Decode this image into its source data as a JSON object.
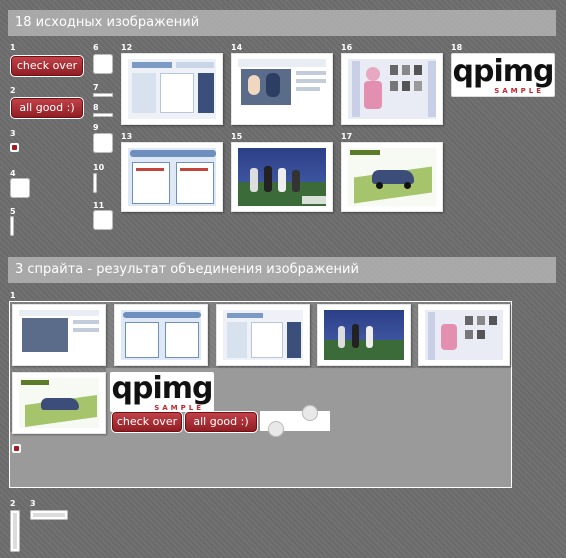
{
  "section_source": {
    "title": "18 исходных изображений"
  },
  "section_sprites": {
    "title": "3 спрайта - результат объединения изображений"
  },
  "items": {
    "n1": "1",
    "n2": "2",
    "n3": "3",
    "n4": "4",
    "n5": "5",
    "n6": "6",
    "n7": "7",
    "n8": "8",
    "n9": "9",
    "n10": "10",
    "n11": "11",
    "n12": "12",
    "n13": "13",
    "n14": "14",
    "n15": "15",
    "n16": "16",
    "n17": "17",
    "n18": "18"
  },
  "sprites": {
    "s1": "1",
    "s2": "2",
    "s3": "3"
  },
  "buttons": {
    "check_over": "check over",
    "all_good": "all good :)"
  },
  "logo": {
    "word": "qpimg",
    "sub": "SAMPLE"
  },
  "colors": {
    "accent_red": "#a11b22",
    "panel_gray": "#afafaf"
  }
}
